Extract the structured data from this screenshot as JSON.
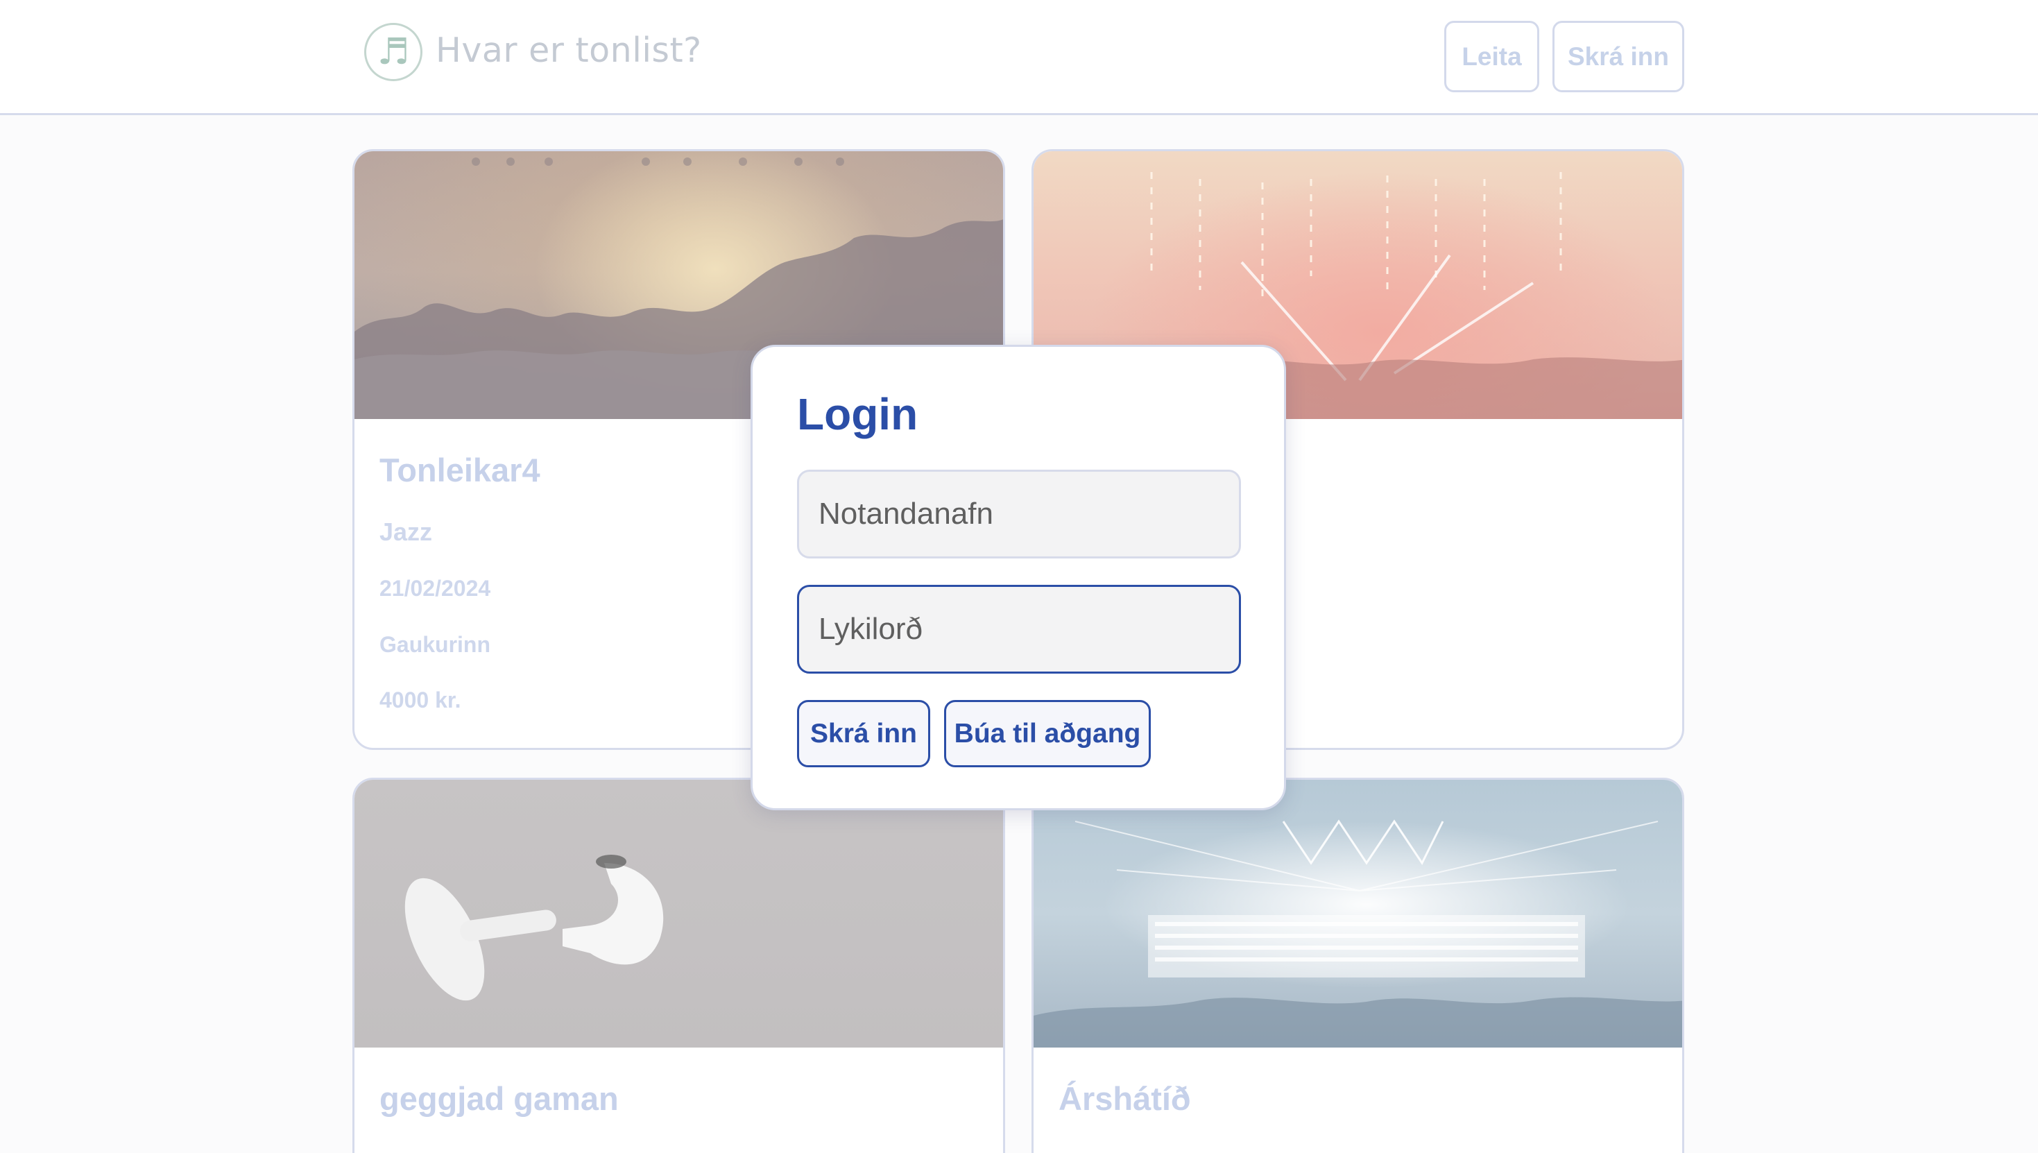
{
  "header": {
    "logo_icon": "music-note-icon",
    "logo_glyph": "♬",
    "brand": "Hvar er tonlist?",
    "search_label": "Leita",
    "login_label": "Skrá inn"
  },
  "events": [
    {
      "title": "Tonleikar4",
      "genre": "Jazz",
      "date": "21/02/2024",
      "venue": "Gaukurinn",
      "price": "4000 kr."
    },
    {
      "title": "",
      "genre": "",
      "date": "",
      "venue": "",
      "price": ""
    },
    {
      "title": "geggjad gaman"
    },
    {
      "title": "Árshátíð"
    }
  ],
  "modal": {
    "title": "Login",
    "username_placeholder": "Notandanafn",
    "password_placeholder": "Lykilorð",
    "login_button": "Skrá inn",
    "create_button": "Búa til aðgang"
  },
  "colors": {
    "accent": "#2b4ea7",
    "muted_text": "#c6d1ea",
    "border": "#d6dbec"
  }
}
